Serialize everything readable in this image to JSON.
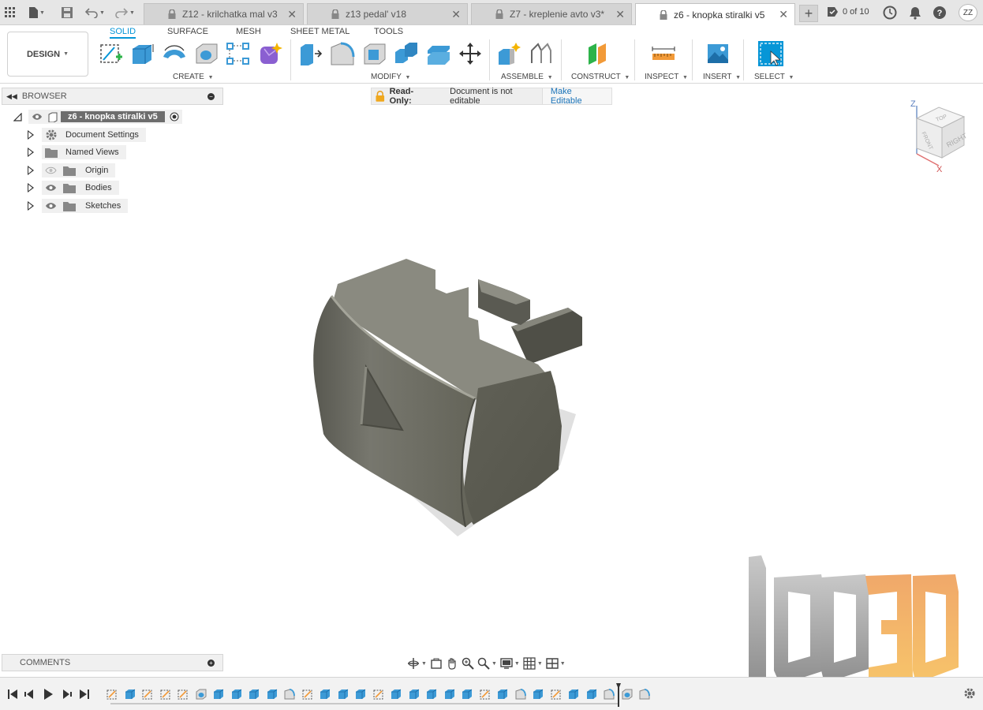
{
  "titlebar": {
    "tabs": [
      {
        "label": "Z12 - krilchatka mal v3",
        "active": false
      },
      {
        "label": "z13 pedal' v18",
        "active": false
      },
      {
        "label": "Z7 - kreplenie avto v3*",
        "active": false
      },
      {
        "label": "z6 - knopka stiralki v5",
        "active": true
      }
    ],
    "job_status": "0 of 10",
    "user_initials": "ZZ",
    "icons": [
      "grid-icon",
      "file-icon",
      "save-icon",
      "undo-icon",
      "redo-icon",
      "lock-icon",
      "close-icon",
      "plus-icon",
      "job-status-icon",
      "clock-icon",
      "bell-icon",
      "help-icon"
    ]
  },
  "toolbar": {
    "workspace": "DESIGN",
    "workspace_tabs": [
      {
        "label": "SOLID",
        "active": true
      },
      {
        "label": "SURFACE",
        "active": false
      },
      {
        "label": "MESH",
        "active": false
      },
      {
        "label": "SHEET METAL",
        "active": false
      },
      {
        "label": "TOOLS",
        "active": false
      }
    ],
    "groups": {
      "create": "CREATE",
      "modify": "MODIFY",
      "assemble": "ASSEMBLE",
      "construct": "CONSTRUCT",
      "inspect": "INSPECT",
      "insert": "INSERT",
      "select": "SELECT"
    }
  },
  "browser": {
    "title": "BROWSER",
    "root": "z6 - knopka stiralki v5",
    "items": [
      {
        "label": "Document Settings",
        "icon": "gear-icon"
      },
      {
        "label": "Named Views",
        "icon": "folder-icon"
      },
      {
        "label": "Origin",
        "icon": "folder-icon",
        "visible": false
      },
      {
        "label": "Bodies",
        "icon": "folder-icon",
        "visible": true
      },
      {
        "label": "Sketches",
        "icon": "folder-icon",
        "visible": true
      }
    ]
  },
  "readonly": {
    "title": "Read-Only:",
    "message": "Document is not editable",
    "button": "Make Editable"
  },
  "viewcube": {
    "axis_z": "Z",
    "axis_x": "X",
    "faces": [
      "TOP",
      "FRONT",
      "RIGHT"
    ]
  },
  "comments": {
    "title": "COMMENTS"
  },
  "colors": {
    "accent": "#0696d7",
    "model": "#6b6b62",
    "watermark_gray": "#9a9a9a",
    "watermark_orange": "#f4a640"
  }
}
